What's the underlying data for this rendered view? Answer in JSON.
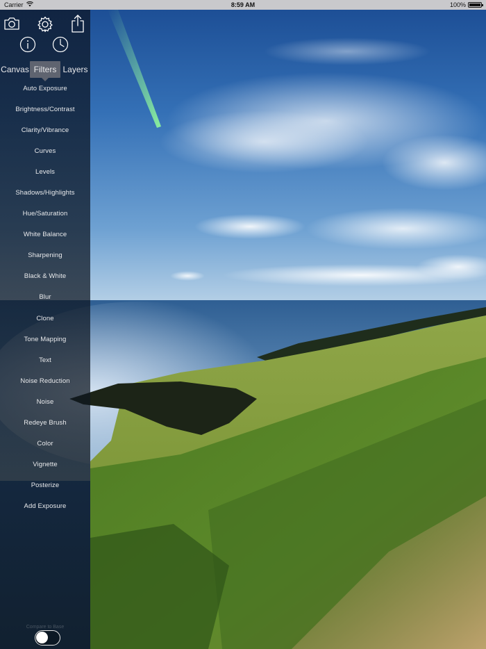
{
  "status_bar": {
    "carrier": "Carrier",
    "wifi_icon": "wifi-icon",
    "time": "8:59 AM",
    "battery_percent": "100%",
    "battery_icon": "battery-icon"
  },
  "toolbar": {
    "icons": [
      "camera-icon",
      "gear-icon",
      "share-icon",
      "info-icon",
      "history-clock-icon"
    ]
  },
  "tabs": [
    {
      "label": "Canvas",
      "active": false
    },
    {
      "label": "Filters",
      "active": true
    },
    {
      "label": "Layers",
      "active": false
    }
  ],
  "filters": [
    "Auto Exposure",
    "Brightness/Contrast",
    "Clarity/Vibrance",
    "Curves",
    "Levels",
    "Shadows/Highlights",
    "Hue/Saturation",
    "White Balance",
    "Sharpening",
    "Black & White",
    "Blur",
    "Clone",
    "Tone Mapping",
    "Text",
    "Noise Reduction",
    "Noise",
    "Redeye Brush",
    "Color",
    "Vignette",
    "Posterize",
    "Add Exposure"
  ],
  "toggle": {
    "label": "Compare to Base",
    "on": false
  },
  "colors": {
    "sidebar_bg": "#0e1622",
    "active_tab": "#78787d",
    "status_bar_bg": "#c9c9cc"
  }
}
